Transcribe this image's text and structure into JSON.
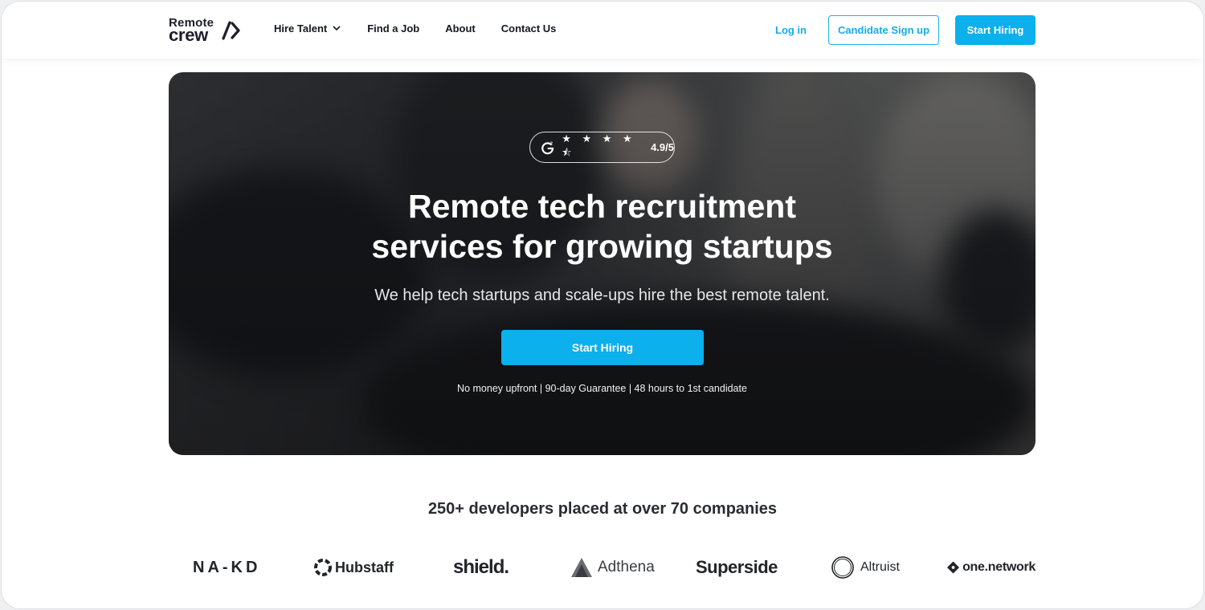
{
  "header": {
    "logo": {
      "top": "Remote",
      "bottom": "crew",
      "mark_icon": "chevron-slash-icon"
    },
    "nav": [
      {
        "label": "Hire Talent",
        "has_dropdown": true
      },
      {
        "label": "Find a Job"
      },
      {
        "label": "About"
      },
      {
        "label": "Contact Us"
      }
    ],
    "login_label": "Log in",
    "candidate_signup_label": "Candidate Sign up",
    "start_hiring_label": "Start Hiring"
  },
  "hero": {
    "rating": {
      "icon": "g2-icon",
      "stars": "★ ★ ★ ★ ⯪",
      "score": "4.9/5"
    },
    "title_line1": "Remote tech recruitment",
    "title_line2": "services for growing startups",
    "subtitle": "We help tech startups and scale-ups hire the best remote talent.",
    "cta_label": "Start Hiring",
    "note": "No money upfront | 90-day Guarantee | 48 hours to 1st candidate"
  },
  "companies": {
    "title": "250+ developers placed at over 70 companies",
    "logos": [
      "NA-KD",
      "Hubstaff",
      "shield.",
      "Adthena",
      "Superside",
      "Altruist",
      "one.network"
    ]
  },
  "colors": {
    "accent": "#0bb0ec",
    "text_dark": "#1d1f24",
    "hero_bg": "#2c2e31"
  }
}
